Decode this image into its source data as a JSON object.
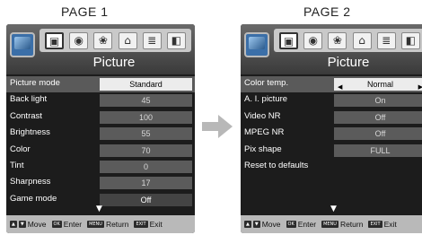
{
  "page1": {
    "label": "PAGE 1",
    "title": "Picture",
    "rows": [
      {
        "label": "Picture mode",
        "value": "Standard"
      },
      {
        "label": "Back light",
        "value": "45"
      },
      {
        "label": "Contrast",
        "value": "100"
      },
      {
        "label": "Brightness",
        "value": "55"
      },
      {
        "label": "Color",
        "value": "70"
      },
      {
        "label": "Tint",
        "value": "0"
      },
      {
        "label": "Sharpness",
        "value": "17"
      },
      {
        "label": "Game mode",
        "value": "Off"
      }
    ]
  },
  "page2": {
    "label": "PAGE 2",
    "title": "Picture",
    "rows": [
      {
        "label": "Color temp.",
        "value": "Normal"
      },
      {
        "label": "A. I. picture",
        "value": "On"
      },
      {
        "label": "Video NR",
        "value": "Off"
      },
      {
        "label": "MPEG NR",
        "value": "Off"
      },
      {
        "label": "Pix shape",
        "value": "FULL"
      },
      {
        "label": "Reset to defaults",
        "value": ""
      }
    ]
  },
  "icons": [
    "picture-icon",
    "audio-icon",
    "setup-icon",
    "lock-icon",
    "channel-icon",
    "usb-icon"
  ],
  "footer": {
    "move": "Move",
    "enter": "Enter",
    "return": "Return",
    "exit": "Exit",
    "ok_key": "OK",
    "menu_key": "MENU",
    "exit_key": "EXIT"
  }
}
